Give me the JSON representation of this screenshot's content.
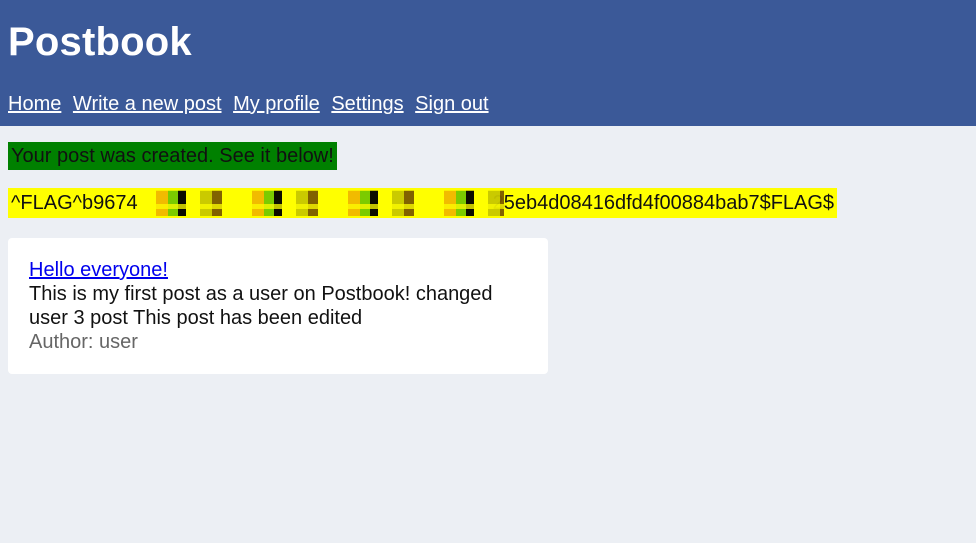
{
  "header": {
    "title": "Postbook",
    "nav": [
      {
        "label": "Home"
      },
      {
        "label": "Write a new post"
      },
      {
        "label": "My profile"
      },
      {
        "label": "Settings"
      },
      {
        "label": "Sign out"
      }
    ]
  },
  "notice": {
    "success_text": "Your post was created. See it below!",
    "flag_text": "^FLAG^b9674",
    "flag_suffix": "25eb4d08416dfd4f00884bab7$FLAG$"
  },
  "post": {
    "title": "Hello everyone!",
    "body": "This is my first post as a user on Postbook! changed user 3 post This post has been edited",
    "author_label": "Author: user"
  },
  "colors": {
    "header_bg": "#3b5998",
    "page_bg": "#eceff4",
    "success_bg": "#008000",
    "flag_bg": "#ffff00",
    "link": "#0000ee"
  }
}
